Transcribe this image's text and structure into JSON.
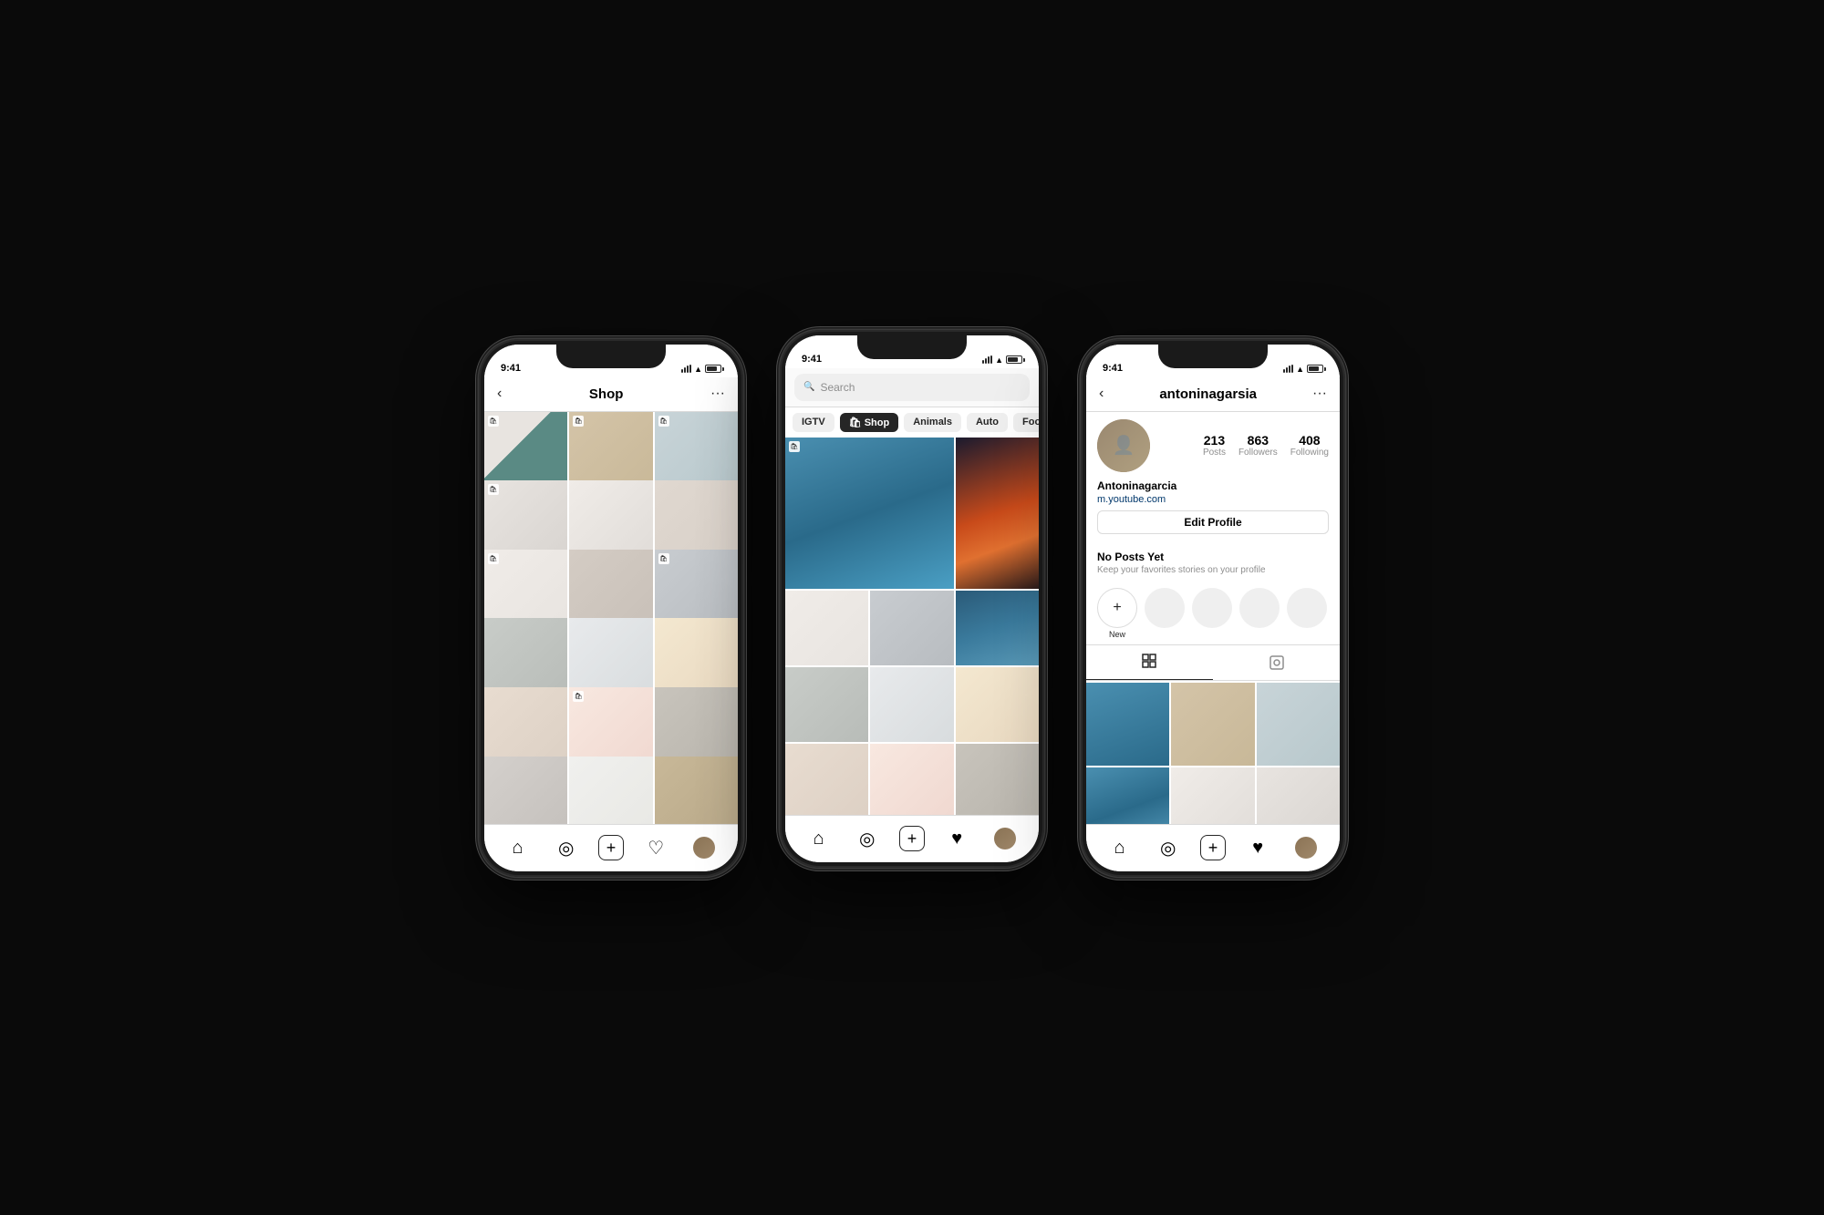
{
  "background": "#0a0a0a",
  "phones": [
    {
      "id": "phone-shop",
      "statusBar": {
        "time": "9:41",
        "icons": [
          "signal",
          "wifi",
          "battery"
        ]
      },
      "navBar": {
        "backLabel": "‹",
        "title": "Shop",
        "menuLabel": "···"
      },
      "bottomNav": [
        "home",
        "search",
        "add",
        "heart",
        "profile"
      ],
      "grid": "shop"
    },
    {
      "id": "phone-search",
      "statusBar": {
        "time": "9:41",
        "icons": [
          "signal",
          "wifi",
          "battery"
        ]
      },
      "searchBar": {
        "placeholder": "Search"
      },
      "filterTabs": [
        {
          "label": "IGTV",
          "active": false
        },
        {
          "label": "🛍 Shop",
          "active": true
        },
        {
          "label": "Animals",
          "active": false
        },
        {
          "label": "Auto",
          "active": false
        },
        {
          "label": "Food",
          "active": false
        }
      ],
      "bottomNav": [
        "home",
        "search",
        "add",
        "heart-filled",
        "profile"
      ],
      "grid": "search"
    },
    {
      "id": "phone-profile",
      "statusBar": {
        "time": "9:41",
        "icons": [
          "signal",
          "wifi",
          "battery"
        ]
      },
      "navBar": {
        "backLabel": "‹",
        "title": "antoninagarsia",
        "menuLabel": "···"
      },
      "profile": {
        "username": "Antoninagarcia",
        "link": "m.youtube.com",
        "stats": [
          {
            "number": "213",
            "label": "Posts"
          },
          {
            "number": "863",
            "label": "Followers"
          },
          {
            "number": "408",
            "label": "Following"
          }
        ],
        "editButton": "Edit Profile",
        "noPostsTitle": "No Posts Yet",
        "noPostsSubtitle": "Keep your favorites stories on your profile",
        "newStoryLabel": "New"
      },
      "bottomNav": [
        "home",
        "search",
        "add",
        "heart-filled",
        "profile"
      ],
      "grid": "profile"
    }
  ]
}
